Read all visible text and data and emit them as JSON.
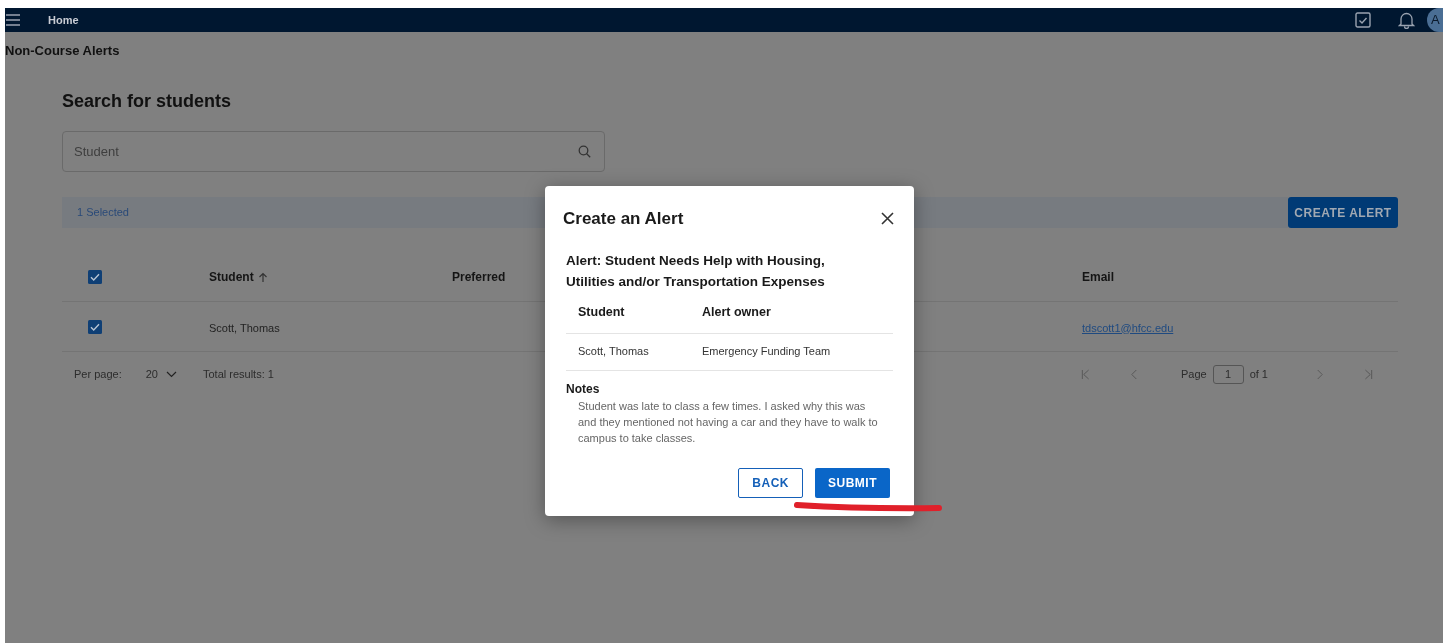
{
  "nav": {
    "title": "Home",
    "avatar": "A"
  },
  "page_title": "Non-Course Alerts",
  "search": {
    "heading": "Search for students",
    "placeholder": "Student"
  },
  "selection": {
    "label": "1 Selected",
    "action": "CREATE ALERT"
  },
  "table": {
    "all_checked": true,
    "columns": [
      {
        "label": "Student",
        "sorted": true
      },
      {
        "label": "Preferred",
        "sorted": false
      },
      {
        "label": "Email",
        "sorted": false
      }
    ],
    "rows": [
      {
        "checked": true,
        "student": "Scott, Thomas",
        "email": "tdscott1@hfcc.edu"
      }
    ]
  },
  "pager": {
    "per_page_label": "Per page:",
    "per_page": "20",
    "total": "Total results: 1",
    "page_label": "Page",
    "page": "1",
    "of": "of 1"
  },
  "dialog": {
    "title": "Create an Alert",
    "alert": "Alert: Student Needs Help with Housing, Utilities and/or Transportation Expenses",
    "columns": [
      "Student",
      "Alert owner"
    ],
    "rows": [
      [
        "Scott, Thomas",
        "Emergency Funding Team"
      ]
    ],
    "notes_label": "Notes",
    "notes": "Student was late to class a few times. I asked why this was and they mentioned not having a car and they have to walk to campus to take classes.",
    "buttons": [
      {
        "kind": "secondary",
        "label": "BACK"
      },
      {
        "kind": "primary",
        "label": "SUBMIT"
      }
    ]
  }
}
